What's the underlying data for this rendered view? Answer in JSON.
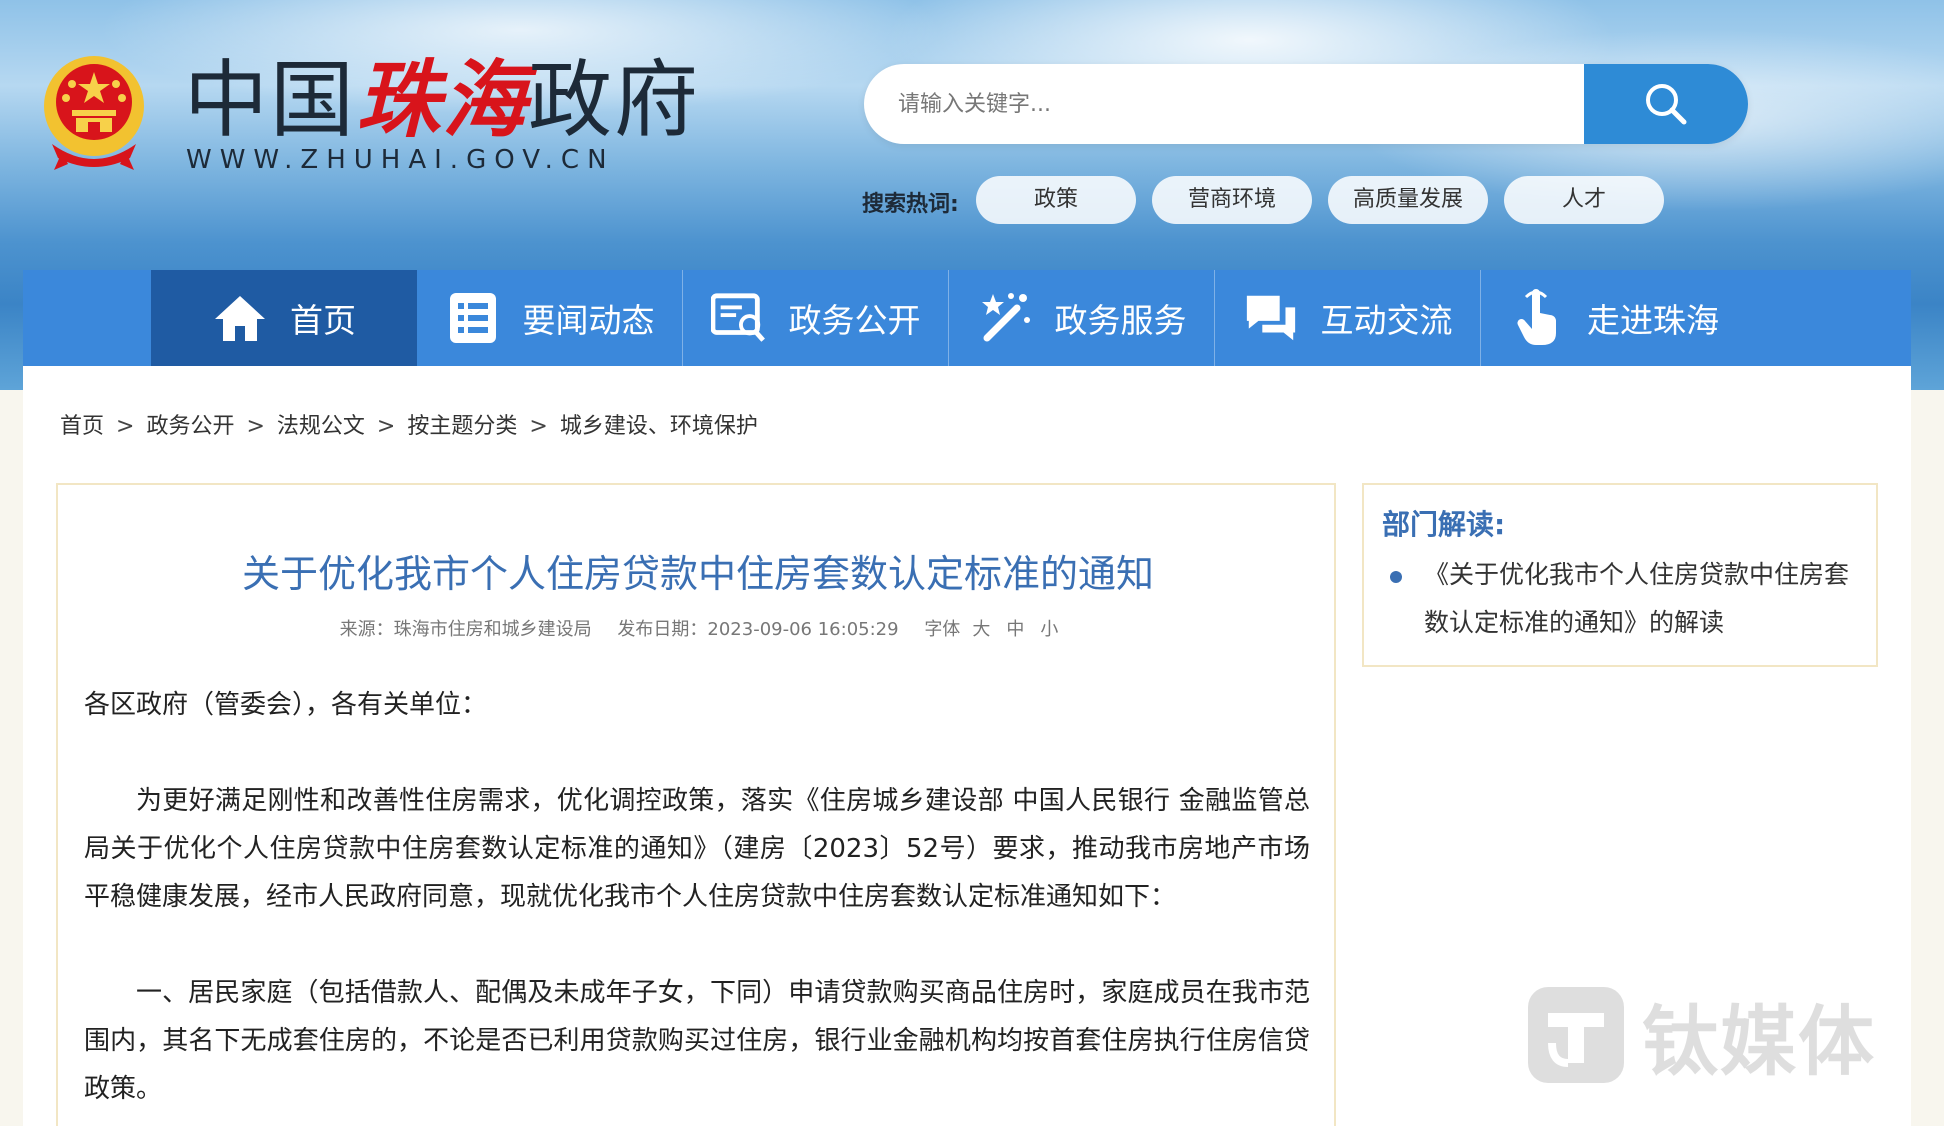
{
  "header": {
    "logo_prefix": "中国",
    "logo_city": "珠海",
    "logo_suffix": "政府",
    "logo_url": "WWW.ZHUHAI.GOV.CN",
    "search_placeholder": "请输入关键字...",
    "hot_label": "搜索热词:",
    "hot_tags": [
      "政策",
      "营商环境",
      "高质量发展",
      "人才"
    ]
  },
  "nav": {
    "items": [
      {
        "label": "首页",
        "icon": "home-icon"
      },
      {
        "label": "要闻动态",
        "icon": "news-list-icon"
      },
      {
        "label": "政务公开",
        "icon": "document-search-icon"
      },
      {
        "label": "政务服务",
        "icon": "magic-wand-icon"
      },
      {
        "label": "互动交流",
        "icon": "chat-bubbles-icon"
      },
      {
        "label": "走进珠海",
        "icon": "pointer-hand-icon"
      }
    ]
  },
  "breadcrumb": [
    "首页",
    "政务公开",
    "法规公文",
    "按主题分类",
    "城乡建设、环境保护"
  ],
  "breadcrumb_sep": ">",
  "article": {
    "title": "关于优化我市个人住房贷款中住房套数认定标准的通知",
    "source": "来源：珠海市住房和城乡建设局",
    "date": "发布日期：2023-09-06 16:05:29",
    "font_label": "字体",
    "font_large": "大",
    "font_medium": "中",
    "font_small": "小",
    "salutation": "各区政府（管委会），各有关单位：",
    "para1": "为更好满足刚性和改善性住房需求，优化调控政策，落实《住房城乡建设部 中国人民银行 金融监管总局关于优化个人住房贷款中住房套数认定标准的通知》（建房〔2023〕52号）要求，推动我市房地产市场平稳健康发展，经市人民政府同意，现就优化我市个人住房贷款中住房套数认定标准通知如下：",
    "para2": "一、居民家庭（包括借款人、配偶及未成年子女，下同）申请贷款购买商品住房时，家庭成员在我市范围内，其名下无成套住房的，不论是否已利用贷款购买过住房，银行业金融机构均按首套住房执行住房信贷政策。"
  },
  "side": {
    "title": "部门解读:",
    "link": "《关于优化我市个人住房贷款中住房套数认定标准的通知》的解读"
  },
  "watermark": {
    "text": "钛媒体"
  },
  "colors": {
    "nav_bg": "#3b88db",
    "nav_active": "#1f5ba3",
    "title_blue": "#3a6fb3",
    "logo_red": "#d8141b",
    "search_btn": "#2e8bd6"
  }
}
